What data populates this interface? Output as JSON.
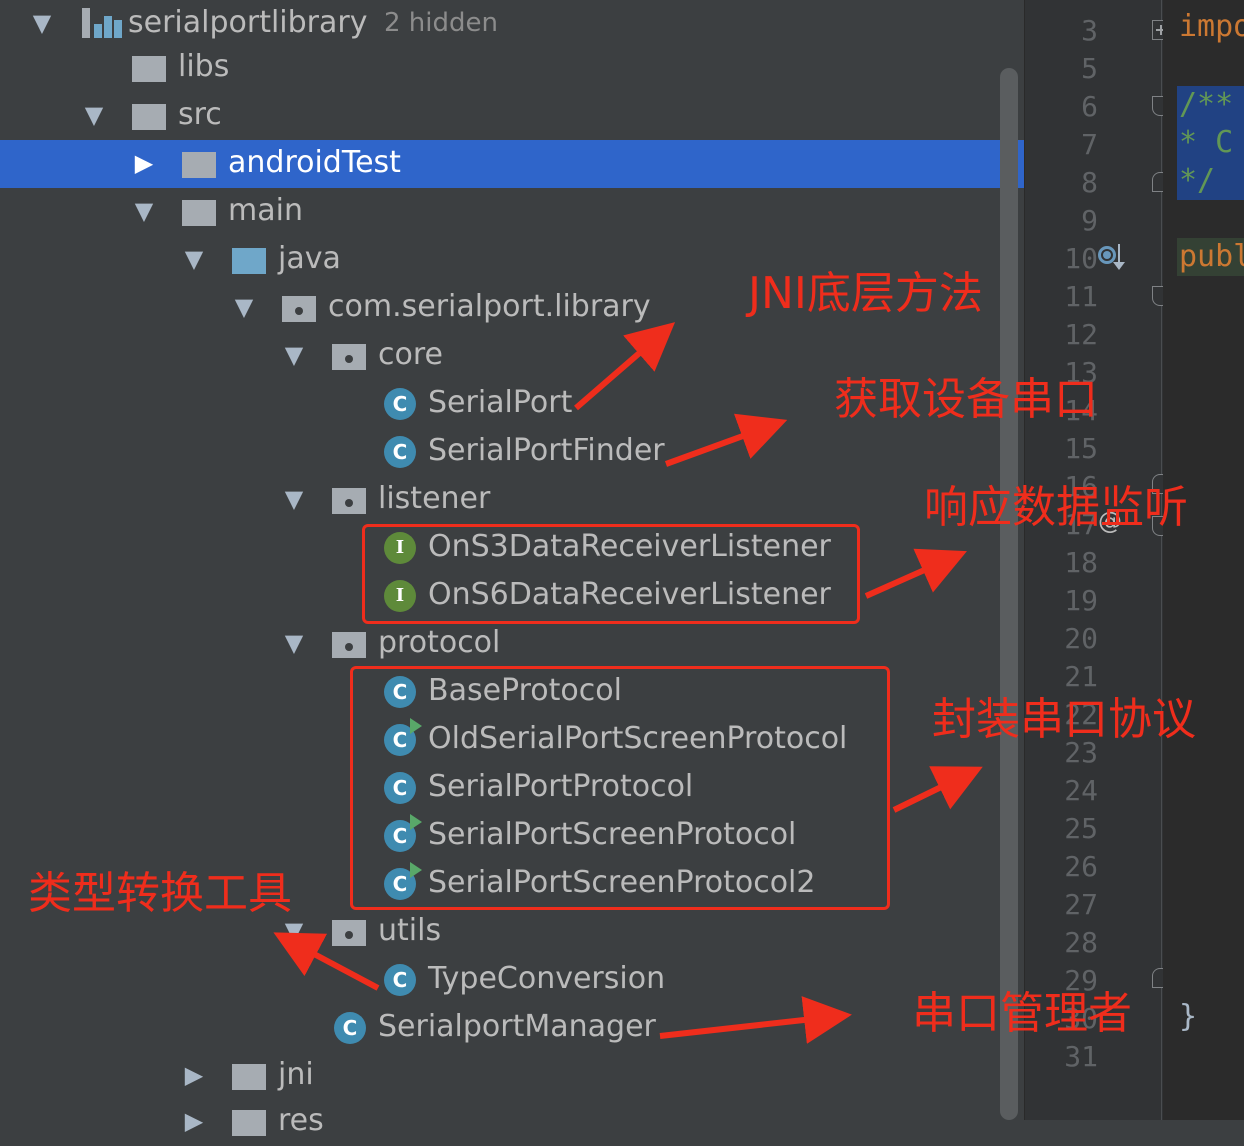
{
  "tree": {
    "module": {
      "name": "serialportlibrary",
      "hint": "2 hidden"
    },
    "items": [
      {
        "label": "libs"
      },
      {
        "label": "src"
      },
      {
        "label": "androidTest"
      },
      {
        "label": "main"
      },
      {
        "label": "java"
      },
      {
        "label": "com.serialport.library"
      },
      {
        "label": "core"
      },
      {
        "label": "SerialPort",
        "badge": "C"
      },
      {
        "label": "SerialPortFinder",
        "badge": "C"
      },
      {
        "label": "listener"
      },
      {
        "label": "OnS3DataReceiverListener",
        "badge": "I"
      },
      {
        "label": "OnS6DataReceiverListener",
        "badge": "I"
      },
      {
        "label": "protocol"
      },
      {
        "label": "BaseProtocol",
        "badge": "C"
      },
      {
        "label": "OldSerialPortScreenProtocol",
        "badge": "C"
      },
      {
        "label": "SerialPortProtocol",
        "badge": "C"
      },
      {
        "label": "SerialPortScreenProtocol",
        "badge": "C"
      },
      {
        "label": "SerialPortScreenProtocol2",
        "badge": "C"
      },
      {
        "label": "utils"
      },
      {
        "label": "TypeConversion",
        "badge": "C"
      },
      {
        "label": "SerialportManager",
        "badge": "C"
      },
      {
        "label": "jni"
      },
      {
        "label": "res"
      }
    ]
  },
  "gutter": {
    "line_numbers": [
      "3",
      "5",
      "6",
      "7",
      "8",
      "9",
      "10",
      "11",
      "12",
      "13",
      "14",
      "15",
      "16",
      "17",
      "18",
      "19",
      "20",
      "21",
      "22",
      "23",
      "24",
      "25",
      "26",
      "27",
      "28",
      "29",
      "30",
      "31"
    ]
  },
  "code": {
    "lines": [
      "impo",
      "/**",
      " * C",
      " */",
      "publ",
      "}"
    ]
  },
  "annotations": {
    "jni": "JNI底层方法",
    "finder": "获取设备串口",
    "listener": "响应数据监听",
    "protocol": "封装串口协议",
    "utils": "类型转换工具",
    "manager": "串口管理者"
  },
  "colors": {
    "background": "#3c3f41",
    "selection": "#2f65ca",
    "annotation": "#ef2d1c",
    "class_icon": "#3f8bb0",
    "interface_icon": "#5e8a3a"
  }
}
